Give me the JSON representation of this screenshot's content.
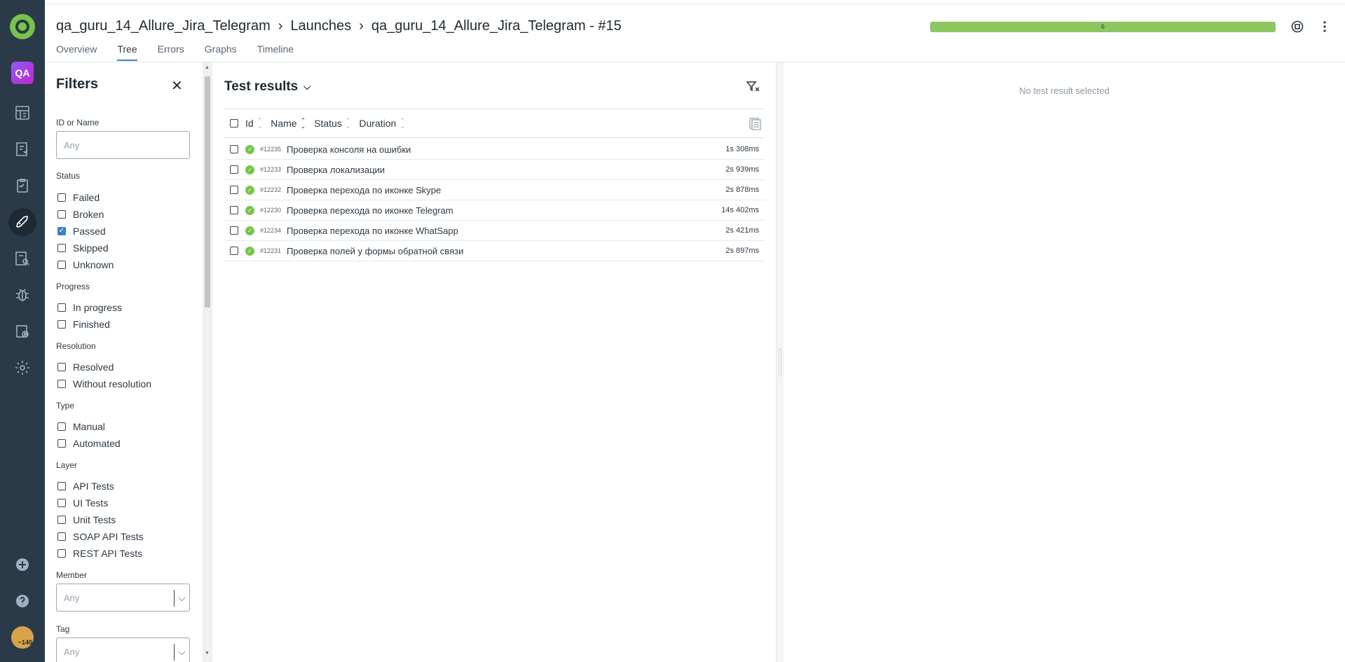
{
  "header": {
    "breadcrumbs": [
      "qa_guru_14_Allure_Jira_Telegram",
      "Launches",
      "qa_guru_14_Allure_Jira_Telegram - #15"
    ],
    "progress_value": "6",
    "progress_fraction": 1.0,
    "progress_color": "#8cc65f"
  },
  "tabs": [
    "Overview",
    "Tree",
    "Errors",
    "Graphs",
    "Timeline"
  ],
  "active_tab": "Tree",
  "nav": {
    "project_badge": "QA",
    "avatar_text": "~140",
    "icons": [
      "dashboard-icon",
      "test-cases-icon",
      "test-plans-icon",
      "launches-icon",
      "analytics-icon",
      "defects-icon",
      "jobs-icon",
      "settings-icon",
      "add-icon",
      "help-icon"
    ]
  },
  "filters": {
    "title": "Filters",
    "id_or_name_label": "ID or Name",
    "id_or_name_placeholder": "Any",
    "status_label": "Status",
    "status_options": [
      {
        "label": "Failed",
        "checked": false
      },
      {
        "label": "Broken",
        "checked": false
      },
      {
        "label": "Passed",
        "checked": true
      },
      {
        "label": "Skipped",
        "checked": false
      },
      {
        "label": "Unknown",
        "checked": false
      }
    ],
    "progress_label": "Progress",
    "progress_options": [
      "In progress",
      "Finished"
    ],
    "resolution_label": "Resolution",
    "resolution_options": [
      "Resolved",
      "Without resolution"
    ],
    "type_label": "Type",
    "type_options": [
      "Manual",
      "Automated"
    ],
    "layer_label": "Layer",
    "layer_options": [
      "API Tests",
      "UI Tests",
      "Unit Tests",
      "SOAP API Tests",
      "REST API Tests"
    ],
    "member_label": "Member",
    "member_placeholder": "Any",
    "tag_label": "Tag",
    "tag_placeholder": "Any"
  },
  "results": {
    "title": "Test results",
    "columns": [
      "Id",
      "Name",
      "Status",
      "Duration"
    ],
    "rows": [
      {
        "id": "#12235",
        "name": "Проверка консоля на ошибки",
        "duration": "1s 308ms"
      },
      {
        "id": "#12233",
        "name": "Проверка локализации",
        "duration": "2s 939ms"
      },
      {
        "id": "#12232",
        "name": "Проверка перехода по иконке Skype",
        "duration": "2s 878ms"
      },
      {
        "id": "#12230",
        "name": "Проверка перехода по иконке Telegram",
        "duration": "14s 402ms"
      },
      {
        "id": "#12234",
        "name": "Проверка перехода по иконке WhatSapp",
        "duration": "2s 421ms"
      },
      {
        "id": "#12231",
        "name": "Проверка полей у формы обратной связи",
        "duration": "2s 897ms"
      }
    ]
  },
  "detail": {
    "empty_text": "No test result selected"
  }
}
